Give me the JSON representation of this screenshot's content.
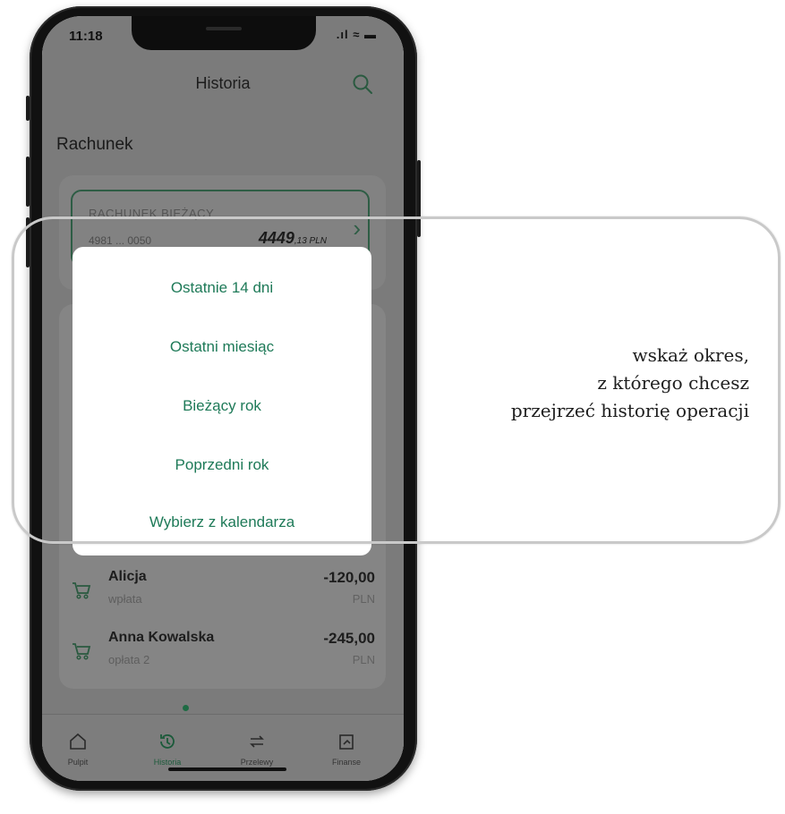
{
  "status_bar": {
    "time": "11:18",
    "icons": ".ıl ≈ ▬"
  },
  "header": {
    "title": "Historia"
  },
  "section": {
    "label": "Rachunek"
  },
  "account": {
    "name": "RACHUNEK BIEŻĄCY",
    "number": "4981 ... 0050",
    "balance": "4449",
    "balance_cents_currency": ",13 PLN"
  },
  "transactions": [
    {
      "name": "Alicja",
      "description": "wpłata",
      "amount": "-120,00",
      "currency": "PLN"
    },
    {
      "name": "Anna Kowalska",
      "description": "opłata 2",
      "amount": "-245,00",
      "currency": "PLN"
    }
  ],
  "period_options": [
    "Ostatnie 14 dni",
    "Ostatni miesiąc",
    "Bieżący rok",
    "Poprzedni rok",
    "Wybierz z kalendarza"
  ],
  "tabbar": {
    "items": [
      {
        "label": "Pulpit",
        "icon": "home-icon"
      },
      {
        "label": "Historia",
        "icon": "history-icon"
      },
      {
        "label": "Przelewy",
        "icon": "transfer-icon"
      },
      {
        "label": "Finanse",
        "icon": "finance-icon"
      }
    ],
    "active": "Historia"
  },
  "caption": {
    "line1": "wskaż okres,",
    "line2": "z którego chcesz",
    "line3": "przejrzeć historię operacji"
  },
  "colors": {
    "accent": "#1e7a58",
    "dim_overlay": "#7b7b7b",
    "callout_border": "#c9c9c9"
  }
}
